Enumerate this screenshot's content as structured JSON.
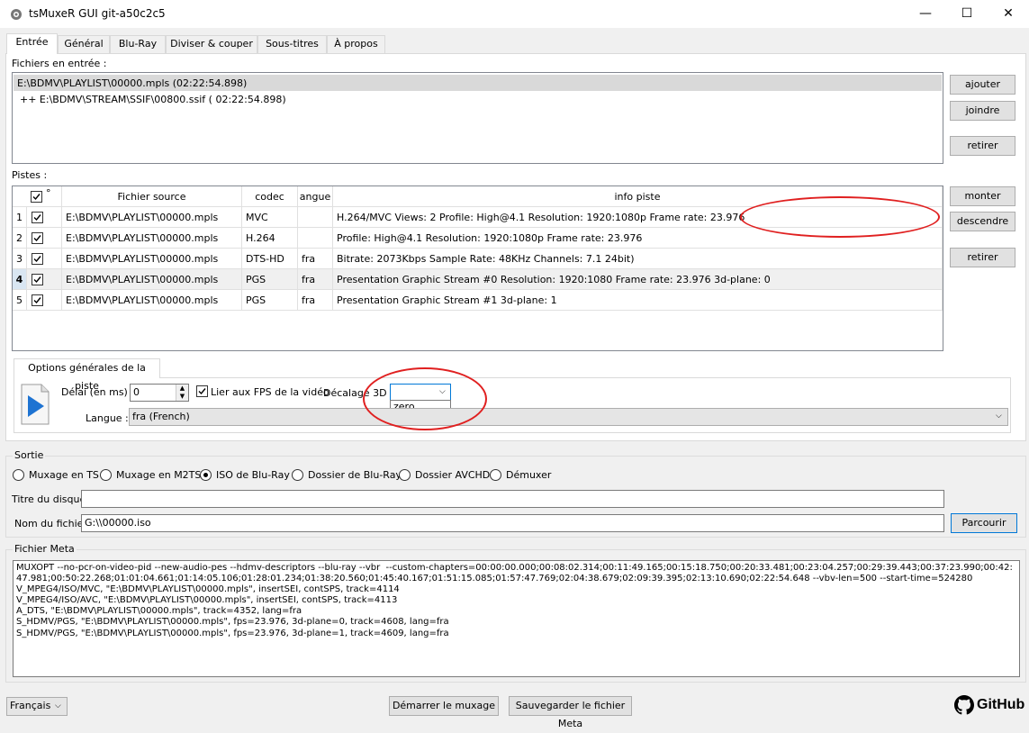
{
  "window": {
    "title": "tsMuxeR GUI git-a50c2c5",
    "controls": {
      "minimize": "—",
      "maximize": "☐",
      "close": "✕"
    }
  },
  "tabs": [
    "Entrée",
    "Général",
    "Blu-Ray",
    "Diviser & couper",
    "Sous-titres",
    "À propos"
  ],
  "input_files": {
    "label": "Fichiers en entrée :",
    "items": [
      "E:\\BDMV\\PLAYLIST\\00000.mpls (02:22:54.898)",
      "++ E:\\BDMV\\STREAM\\SSIF\\00800.ssif ( 02:22:54.898)"
    ],
    "buttons": {
      "add": "ajouter",
      "join": "joindre",
      "remove": "retirer"
    }
  },
  "tracks": {
    "label": "Pistes :",
    "headers": {
      "check": "°",
      "source": "Fichier source",
      "codec": "codec",
      "lang": "angue",
      "info": "info piste"
    },
    "rows": [
      {
        "num": "1",
        "source": "E:\\BDMV\\PLAYLIST\\00000.mpls",
        "codec": "MVC",
        "lang": "",
        "info": "H.264/MVC Views: 2 Profile: High@4.1  Resolution: 1920:1080p  Frame rate: 23.976"
      },
      {
        "num": "2",
        "source": "E:\\BDMV\\PLAYLIST\\00000.mpls",
        "codec": "H.264",
        "lang": "",
        "info": "Profile: High@4.1  Resolution: 1920:1080p  Frame rate: 23.976"
      },
      {
        "num": "3",
        "source": "E:\\BDMV\\PLAYLIST\\00000.mpls",
        "codec": "DTS-HD",
        "lang": "fra",
        "info": "Bitrate: 2073Kbps  Sample Rate: 48KHz  Channels: 7.1 24bit)"
      },
      {
        "num": "4",
        "source": "E:\\BDMV\\PLAYLIST\\00000.mpls",
        "codec": "PGS",
        "lang": "fra",
        "info": "Presentation Graphic Stream #0 Resolution: 1920:1080 Frame rate: 23.976   3d-plane: 0"
      },
      {
        "num": "5",
        "source": "E:\\BDMV\\PLAYLIST\\00000.mpls",
        "codec": "PGS",
        "lang": "fra",
        "info": "Presentation Graphic Stream #1   3d-plane: 1"
      }
    ],
    "buttons": {
      "up": "monter",
      "down": "descendre",
      "remove": "retirer"
    }
  },
  "track_options": {
    "tab": "Options générales de la piste",
    "delay_label": "Délai (en ms) :",
    "delay_value": "0",
    "fps_label": "Lier aux FPS de la vidéo",
    "offset_label": "Décalage 3D :",
    "offset_option": "zero",
    "lang_label": "Langue :",
    "lang_value": "fra (French)"
  },
  "output": {
    "title": "Sortie",
    "modes": [
      "Muxage en TS",
      "Muxage en M2TS",
      "ISO de Blu-Ray",
      "Dossier de Blu-Ray",
      "Dossier AVCHD",
      "Démuxer"
    ],
    "selected": 2,
    "disc_title_label": "Titre du disque",
    "disc_title_value": "",
    "filename_label": "Nom du fichier",
    "filename_value": "G:\\\\00000.iso",
    "browse": "Parcourir"
  },
  "meta": {
    "title": "Fichier Meta",
    "text": "MUXOPT --no-pcr-on-video-pid --new-audio-pes --hdmv-descriptors --blu-ray --vbr  --custom-chapters=00:00:00.000;00:08:02.314;00:11:49.165;00:15:18.750;00:20:33.481;00:23:04.257;00:29:39.443;00:37:23.990;00:42:47.981;00:50:22.268;01:01:04.661;01:14:05.106;01:28:01.234;01:38:20.560;01:45:40.167;01:51:15.085;01:57:47.769;02:04:38.679;02:09:39.395;02:13:10.690;02:22:54.648 --vbv-len=500 --start-time=524280\nV_MPEG4/ISO/MVC, \"E:\\BDMV\\PLAYLIST\\00000.mpls\", insertSEI, contSPS, track=4114\nV_MPEG4/ISO/AVC, \"E:\\BDMV\\PLAYLIST\\00000.mpls\", insertSEI, contSPS, track=4113\nA_DTS, \"E:\\BDMV\\PLAYLIST\\00000.mpls\", track=4352, lang=fra\nS_HDMV/PGS, \"E:\\BDMV\\PLAYLIST\\00000.mpls\", fps=23.976, 3d-plane=0, track=4608, lang=fra\nS_HDMV/PGS, \"E:\\BDMV\\PLAYLIST\\00000.mpls\", fps=23.976, 3d-plane=1, track=4609, lang=fra"
  },
  "footer": {
    "language": "Français",
    "start": "Démarrer le muxage",
    "save_meta": "Sauvegarder le fichier Meta",
    "github": "GitHub"
  }
}
